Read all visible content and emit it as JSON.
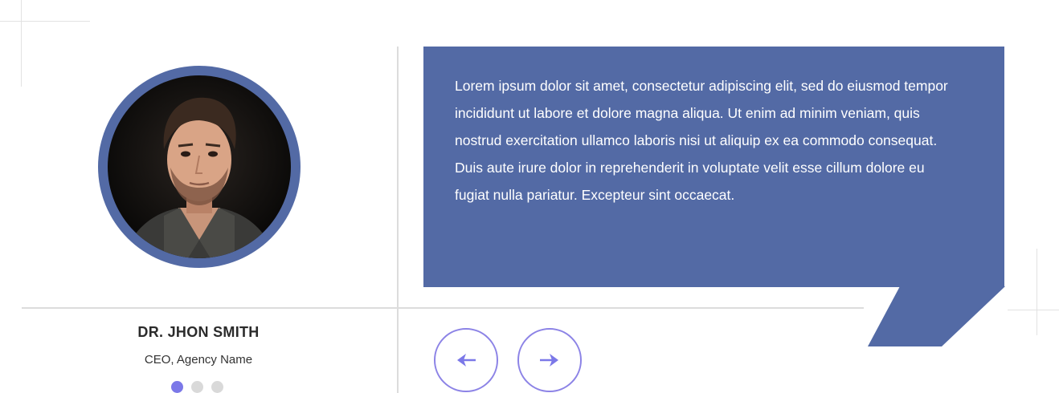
{
  "testimonial": {
    "name": "DR. JHON SMITH",
    "role": "CEO, Agency Name",
    "quote": "Lorem ipsum dolor sit amet, consectetur adipiscing elit, sed do eiusmod tempor incididunt ut labore et dolore magna aliqua. Ut enim ad minim veniam, quis nostrud exercitation ullamco laboris nisi ut aliquip ex ea commodo consequat. Duis aute irure dolor in reprehenderit in voluptate velit esse cillum dolore eu fugiat nulla pariatur. Excepteur sint occaecat."
  },
  "pagination": {
    "total": 3,
    "active_index": 0
  },
  "navigation": {
    "prev_icon": "arrow-left-icon",
    "next_icon": "arrow-right-icon"
  },
  "colors": {
    "accent": "#536aa5",
    "button_border": "#8c83e6",
    "dot_active": "#7b78e8",
    "dot_inactive": "#d9d9d9"
  }
}
